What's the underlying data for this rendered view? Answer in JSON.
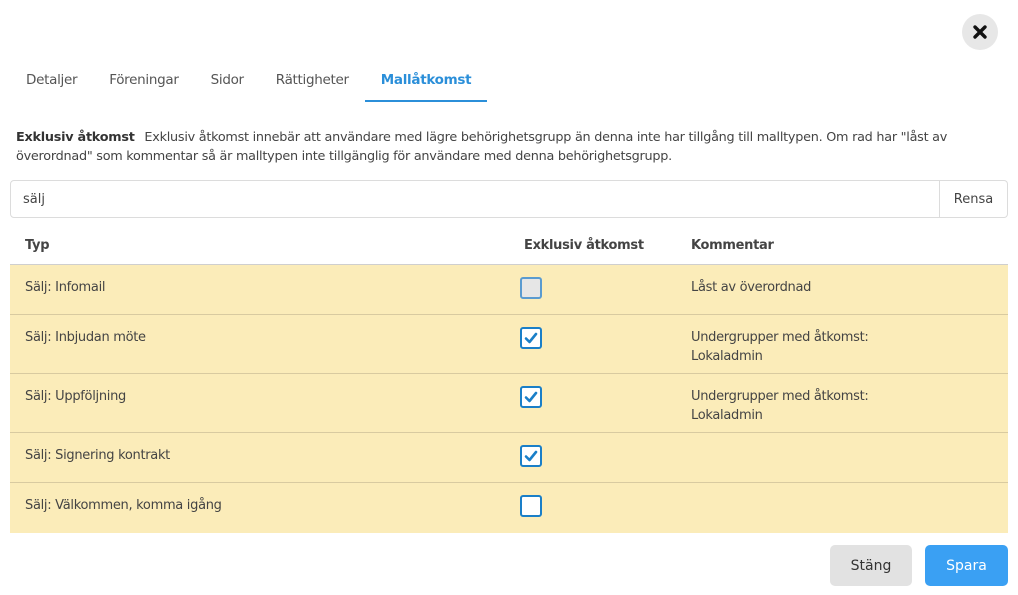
{
  "tabs": [
    {
      "label": "Detaljer",
      "active": false
    },
    {
      "label": "Föreningar",
      "active": false
    },
    {
      "label": "Sidor",
      "active": false
    },
    {
      "label": "Rättigheter",
      "active": false
    },
    {
      "label": "Mallåtkomst",
      "active": true
    }
  ],
  "info": {
    "label": "Exklusiv åtkomst",
    "text": "Exklusiv åtkomst innebär att användare med lägre behörighetsgrupp än denna inte har tillgång till malltypen. Om rad har \"låst av överordnad\" som kommentar så är malltypen inte tillgänglig för användare med denna behörighetsgrupp."
  },
  "search": {
    "value": "sälj",
    "clear_label": "Rensa"
  },
  "table": {
    "headers": {
      "type": "Typ",
      "exclusive": "Exklusiv åtkomst",
      "comment": "Kommentar"
    },
    "rows": [
      {
        "type": "Sälj: Infomail",
        "checked": false,
        "disabled": true,
        "comment_line1": "Låst av överordnad",
        "comment_line2": ""
      },
      {
        "type": "Sälj: Inbjudan möte",
        "checked": true,
        "disabled": false,
        "comment_line1": "Undergrupper med åtkomst:",
        "comment_line2": "Lokaladmin"
      },
      {
        "type": "Sälj: Uppföljning",
        "checked": true,
        "disabled": false,
        "comment_line1": "Undergrupper med åtkomst:",
        "comment_line2": "Lokaladmin"
      },
      {
        "type": "Sälj: Signering kontrakt",
        "checked": true,
        "disabled": false,
        "comment_line1": "",
        "comment_line2": ""
      },
      {
        "type": "Sälj: Välkommen, komma igång",
        "checked": false,
        "disabled": false,
        "comment_line1": "",
        "comment_line2": ""
      }
    ]
  },
  "footer": {
    "close_label": "Stäng",
    "save_label": "Spara"
  },
  "colors": {
    "accent": "#2b8fd9",
    "row_highlight": "#fbecb9",
    "save_button": "#3aa0f3",
    "checkbox_border": "#1a7fc8"
  },
  "icons": {
    "close": "close-x-icon",
    "check": "checkmark-icon"
  }
}
